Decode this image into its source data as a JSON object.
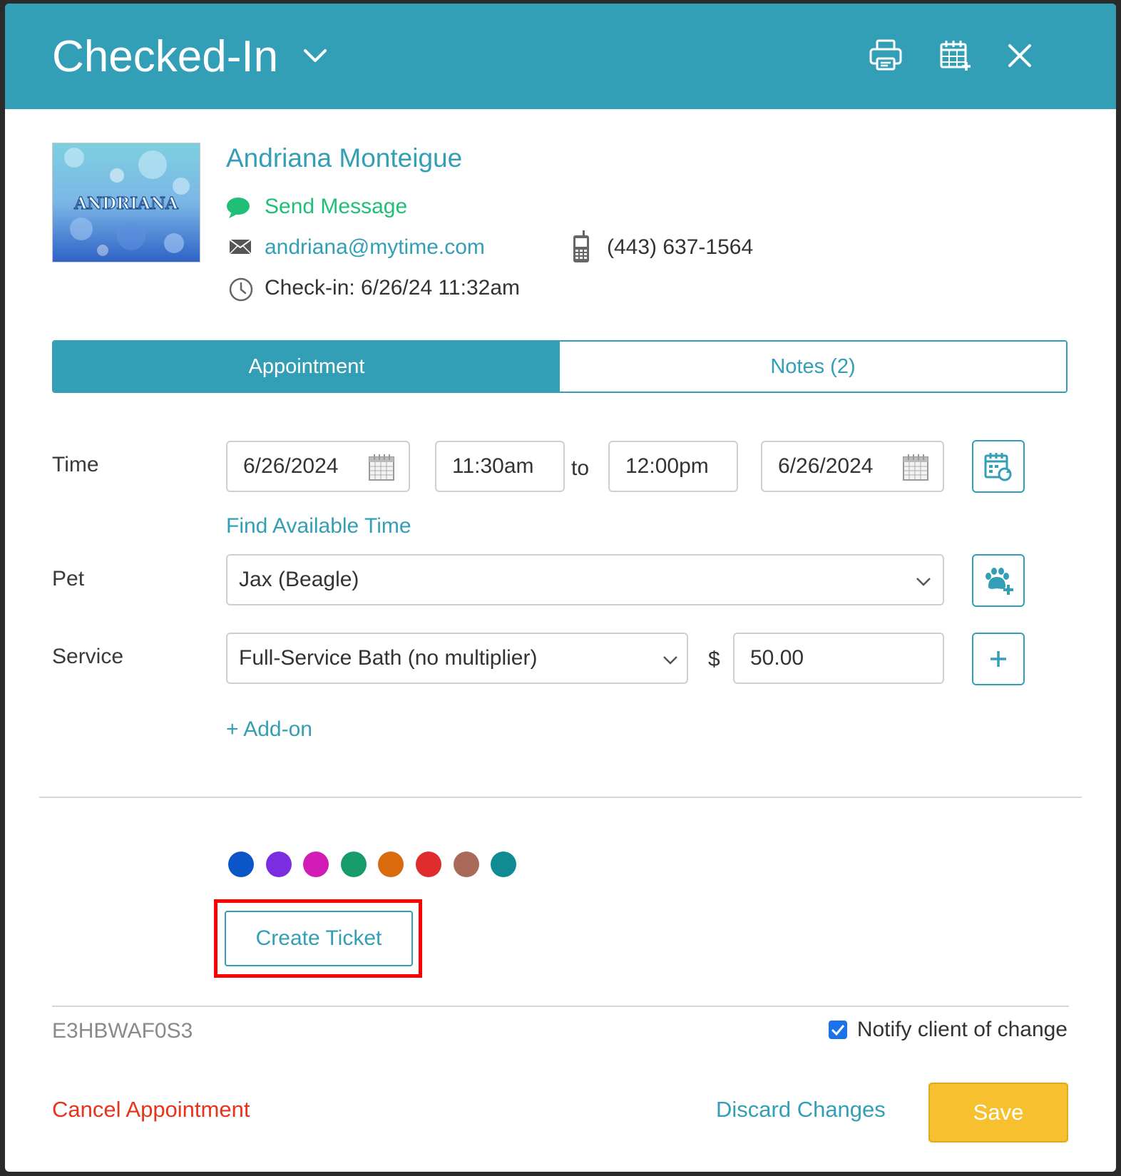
{
  "header": {
    "title": "Checked-In",
    "color": "#339fb6"
  },
  "client": {
    "avatar_text": "ANDRIANA",
    "name": "Andriana Monteigue",
    "send_message": "Send Message",
    "email": "andriana@mytime.com",
    "phone": "(443) 637-1564",
    "checkin": "Check-in: 6/26/24 11:32am"
  },
  "tabs": [
    {
      "label": "Appointment",
      "active": true
    },
    {
      "label": "Notes (2)",
      "active": false
    }
  ],
  "time": {
    "label": "Time",
    "start_date": "6/26/2024",
    "start_time": "11:30am",
    "to": "to",
    "end_time": "12:00pm",
    "end_date": "6/26/2024",
    "find_available": "Find Available Time"
  },
  "pet": {
    "label": "Pet",
    "value": "Jax (Beagle)"
  },
  "service": {
    "label": "Service",
    "value": "Full-Service Bath (no multiplier)",
    "currency": "$",
    "price": "50.00",
    "add_on": "+ Add-on"
  },
  "colors": [
    "#0b55c9",
    "#7b2ee0",
    "#d11db6",
    "#169b6a",
    "#d96a0e",
    "#e02c2c",
    "#aa6a5a",
    "#108a93"
  ],
  "create_ticket": "Create Ticket",
  "footer": {
    "code": "E3HBWAF0S3",
    "notify_label": "Notify client of change",
    "notify_checked": true,
    "cancel": "Cancel Appointment",
    "discard": "Discard Changes",
    "save": "Save"
  }
}
